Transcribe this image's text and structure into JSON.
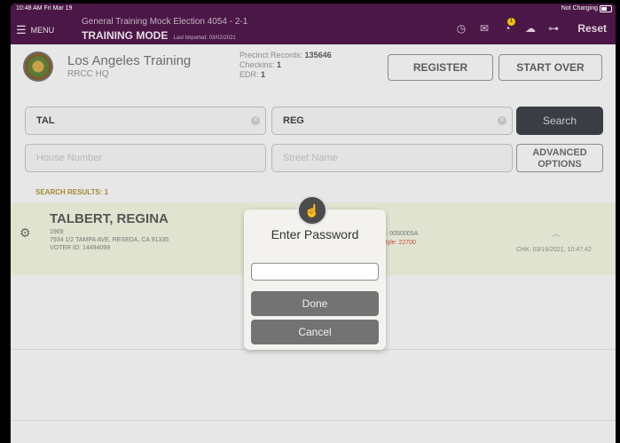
{
  "statusbar": {
    "time": "10:48 AM  Fri Mar 19",
    "charging": "Not Charging"
  },
  "header": {
    "menu_label": "MENU",
    "election": "General Training Mock Election 4054 - 2-1",
    "mode": "TRAINING MODE",
    "last_imported": "Last Imported: 03/02/2021",
    "notification_count": "1",
    "reset_label": "Reset"
  },
  "site": {
    "name": "Los Angeles Training",
    "sub": "RRCC HQ",
    "precinct_records_label": "Precinct Records:",
    "precinct_records": "135646",
    "checkins_label": "Checkins:",
    "checkins": "1",
    "edr_label": "EDR:",
    "edr": "1"
  },
  "actions": {
    "register": "REGISTER",
    "start_over": "START OVER"
  },
  "search": {
    "last_name": "TAL",
    "first_name": "REG",
    "search_label": "Search",
    "house_number_placeholder": "House Number",
    "street_name_placeholder": "Street Name",
    "advanced_line1": "ADVANCED",
    "advanced_line2": "OPTIONS"
  },
  "results": {
    "header": "SEARCH RESULTS: 1",
    "voter": {
      "name": "TALBERT, REGINA",
      "year": "1969",
      "address": "7934 1/2 TAMPA AVE, RESEDA, CA 91335",
      "voter_id": "VOTER ID: 14494099",
      "precinct": "ct: 0050005A",
      "ballot_style": "Style: 22700",
      "check_in": "CHK: 03/19/2021, 10:47:42"
    }
  },
  "modal": {
    "title": "Enter Password",
    "password_value": "",
    "done_label": "Done",
    "cancel_label": "Cancel"
  }
}
